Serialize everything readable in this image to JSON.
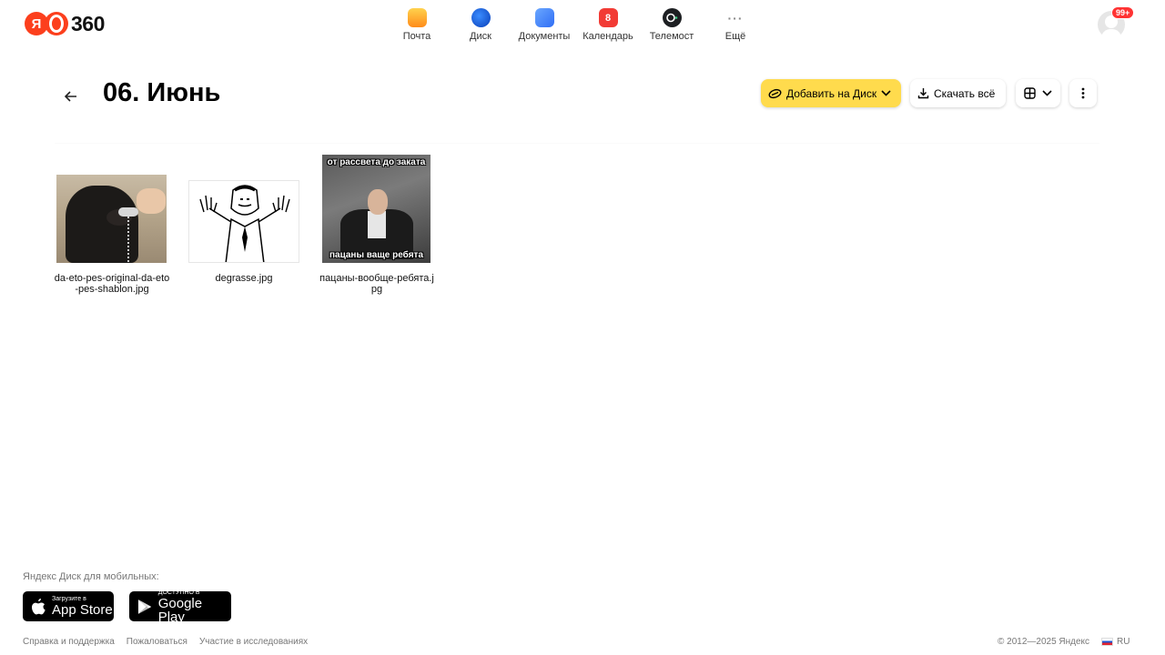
{
  "header": {
    "logo_text": "360",
    "logo_ya": "Я",
    "services": [
      {
        "label": "Почта",
        "icon": "mail-icon"
      },
      {
        "label": "Диск",
        "icon": "disk-icon"
      },
      {
        "label": "Документы",
        "icon": "documents-icon"
      },
      {
        "label": "Календарь",
        "icon": "calendar-icon",
        "icon_text": "8"
      },
      {
        "label": "Телемост",
        "icon": "telemost-icon"
      },
      {
        "label": "Ещё",
        "icon": "more-icon",
        "icon_text": "···"
      }
    ],
    "notifications_badge": "99+"
  },
  "toolbar": {
    "title": "06. Июнь",
    "add_label": "Добавить на Диск",
    "download_label": "Скачать всё"
  },
  "files": [
    {
      "name": "da-eto-pes-original-da-eto-pes-shablon.jpg"
    },
    {
      "name": "degrasse.jpg"
    },
    {
      "name": "пацаны-вообще-ребята.jpg",
      "caption_top": "от рассвета до заката",
      "caption_bottom": "пацаны ваще ребята"
    }
  ],
  "footer": {
    "mobile_label": "Яндекс Диск для мобильных:",
    "app_store_small": "Загрузите в",
    "app_store_big": "App Store",
    "google_small": "ДОСТУПНО В",
    "google_big": "Google Play",
    "links": [
      "Справка и поддержка",
      "Пожаловаться",
      "Участие в исследованиях"
    ],
    "copyright": "© 2012—2025 Яндекс",
    "lang": "RU"
  },
  "colors": {
    "accent_yellow": "#ffdb4d",
    "brand_red": "#fc3f1d"
  }
}
